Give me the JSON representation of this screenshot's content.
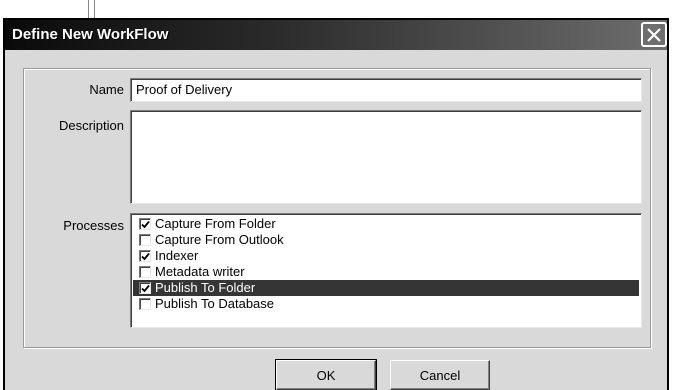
{
  "dialog": {
    "title": "Define New WorkFlow"
  },
  "form": {
    "name_label": "Name",
    "name_value": "Proof of Delivery",
    "description_label": "Description",
    "description_value": "",
    "processes_label": "Processes",
    "processes": [
      {
        "label": "Capture From Folder",
        "checked": true,
        "selected": false
      },
      {
        "label": "Capture From Outlook",
        "checked": false,
        "selected": false
      },
      {
        "label": "Indexer",
        "checked": true,
        "selected": false
      },
      {
        "label": "Metadata writer",
        "checked": false,
        "selected": false
      },
      {
        "label": "Publish To Folder",
        "checked": true,
        "selected": true
      },
      {
        "label": "Publish To Database",
        "checked": false,
        "selected": false
      }
    ]
  },
  "buttons": {
    "ok_label": "OK",
    "cancel_label": "Cancel"
  },
  "icons": {
    "close": "close-icon",
    "check": "check-icon"
  },
  "colors": {
    "title_bg": "#0a0a0a",
    "selected_row": "#353535"
  }
}
